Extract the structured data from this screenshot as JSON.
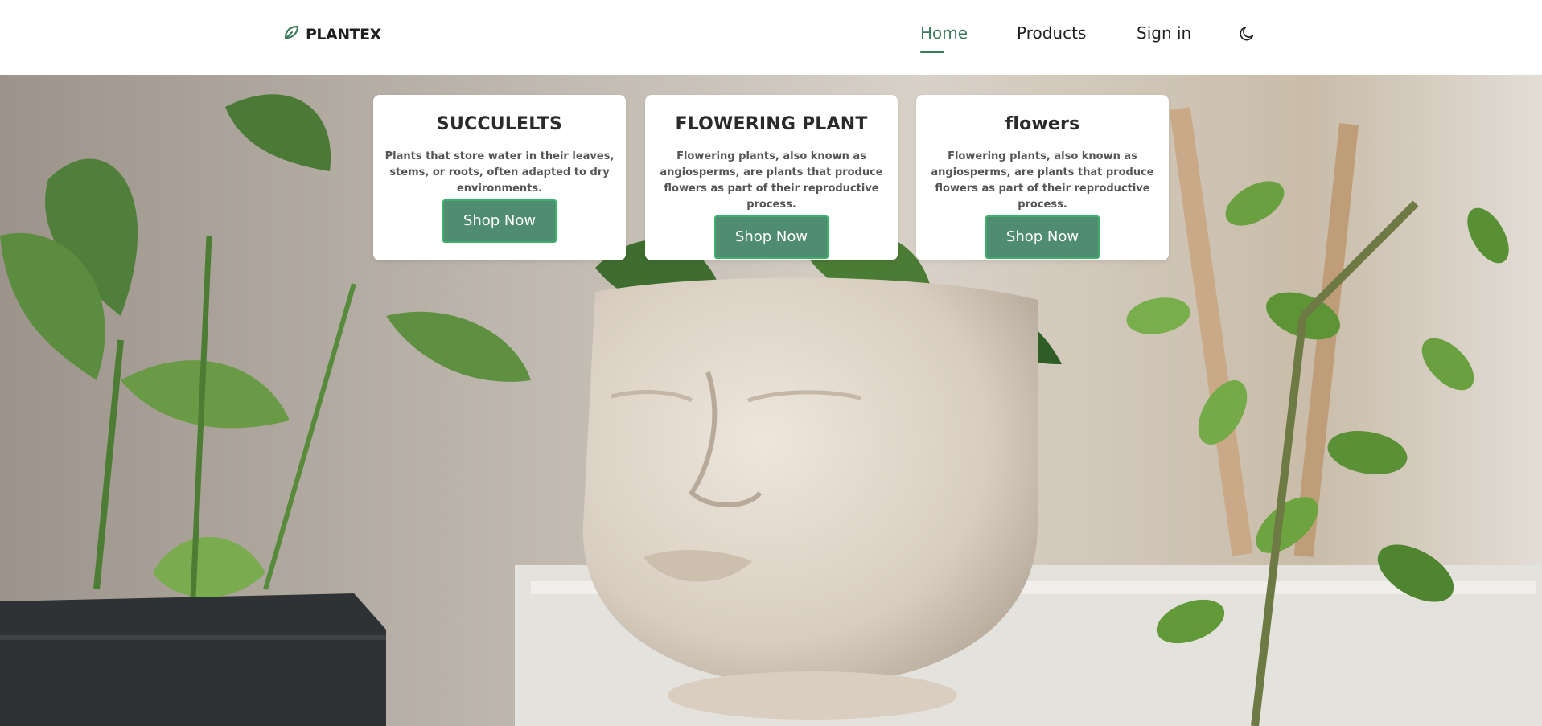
{
  "brand": {
    "name": "PLANTEX",
    "icon": "leaf-icon",
    "color": "#3b7a5a"
  },
  "nav": {
    "items": [
      {
        "label": "Home",
        "active": true
      },
      {
        "label": "Products",
        "active": false
      },
      {
        "label": "Sign in",
        "active": false
      }
    ],
    "theme_toggle_icon": "moon-icon"
  },
  "cards": [
    {
      "title": "SUCCULELTS",
      "description": "Plants that store water in their leaves, stems, or roots, often adapted to dry environments.",
      "button": "Shop Now"
    },
    {
      "title": "FLOWERING PLANT",
      "description": "Flowering plants, also known as angiosperms, are plants that produce flowers as part of their reproductive process.",
      "button": "Shop Now"
    },
    {
      "title": "flowers",
      "description": "Flowering plants, also known as angiosperms, are plants that produce flowers as part of their reproductive process.",
      "button": "Shop Now"
    }
  ],
  "colors": {
    "accent": "#3b7a5a",
    "button_bg": "#4f8c72",
    "button_border": "#3fae6c"
  }
}
